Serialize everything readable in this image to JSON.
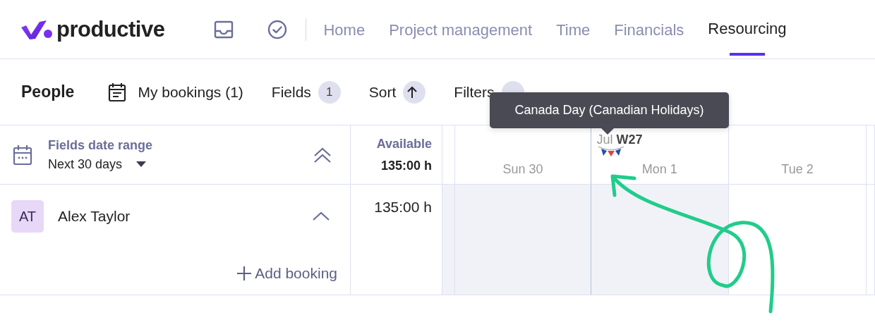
{
  "app": {
    "logo_text": "productive"
  },
  "nav": {
    "tabs": [
      {
        "label": "Home",
        "selected": false
      },
      {
        "label": "Project management",
        "selected": false
      },
      {
        "label": "Time",
        "selected": false
      },
      {
        "label": "Financials",
        "selected": false
      },
      {
        "label": "Resourcing",
        "selected": true
      }
    ]
  },
  "toolbar": {
    "title": "People",
    "my_bookings": "My bookings (1)",
    "fields": {
      "label": "Fields",
      "count": "1"
    },
    "sort": {
      "label": "Sort"
    },
    "filters": {
      "label": "Filters"
    }
  },
  "grid": {
    "date_range": {
      "label": "Fields date range",
      "value": "Next 30 days"
    },
    "available": {
      "label": "Available",
      "total": "135:00 h"
    },
    "days": [
      {
        "label": "Sun 30",
        "shaded": true
      },
      {
        "label": "Mon 1",
        "shaded": true,
        "holiday": true,
        "week": {
          "month": "Jul",
          "week": "W27"
        }
      },
      {
        "label": "Tue 2",
        "shaded": false
      }
    ],
    "people": [
      {
        "initials": "AT",
        "name": "Alex Taylor",
        "available": "135:00 h",
        "expanded": true,
        "add_label": "Add booking"
      }
    ]
  },
  "tooltip": {
    "text": "Canada Day (Canadian Holidays)"
  }
}
